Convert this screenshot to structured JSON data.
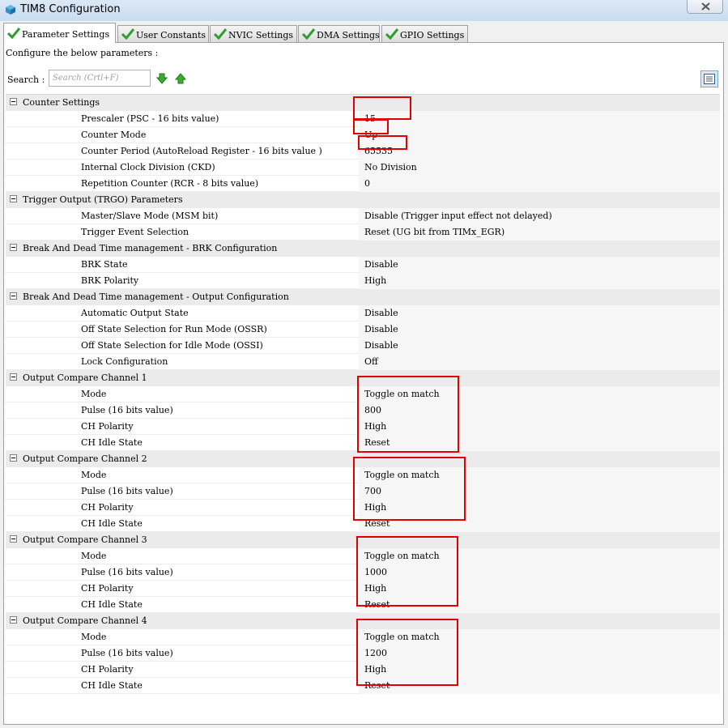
{
  "window": {
    "title": "TIM8 Configuration",
    "icon": "app-cube-icon",
    "close_icon": "close-icon"
  },
  "tabs": [
    {
      "label": "Parameter Settings",
      "active": true,
      "icon": "check-icon"
    },
    {
      "label": "User Constants",
      "active": false,
      "icon": "check-icon"
    },
    {
      "label": "NVIC Settings",
      "active": false,
      "icon": "check-icon"
    },
    {
      "label": "DMA Settings",
      "active": false,
      "icon": "check-icon"
    },
    {
      "label": "GPIO Settings",
      "active": false,
      "icon": "check-icon"
    }
  ],
  "panel": {
    "instruction": "Configure the below parameters :",
    "search_label": "Search :",
    "search_placeholder": "Search (Crtl+F)",
    "next_icon": "arrow-down-icon",
    "prev_icon": "arrow-up-icon",
    "view_icon": "list-view-icon"
  },
  "groups": [
    {
      "title": "Counter Settings",
      "params": [
        {
          "name": "Prescaler (PSC - 16 bits value)",
          "value": "15"
        },
        {
          "name": "Counter Mode",
          "value": "Up"
        },
        {
          "name": "Counter Period (AutoReload Register - 16 bits value )",
          "value": "65535"
        },
        {
          "name": "Internal Clock Division (CKD)",
          "value": "No Division"
        },
        {
          "name": "Repetition Counter (RCR - 8 bits value)",
          "value": "0"
        }
      ]
    },
    {
      "title": "Trigger Output (TRGO) Parameters",
      "params": [
        {
          "name": "Master/Slave Mode (MSM bit)",
          "value": "Disable (Trigger input effect not delayed)"
        },
        {
          "name": "Trigger Event Selection",
          "value": "Reset (UG bit from TIMx_EGR)"
        }
      ]
    },
    {
      "title": "Break And Dead Time management - BRK Configuration",
      "params": [
        {
          "name": "BRK State",
          "value": "Disable"
        },
        {
          "name": "BRK Polarity",
          "value": "High"
        }
      ]
    },
    {
      "title": "Break And Dead Time management - Output Configuration",
      "params": [
        {
          "name": "Automatic Output State",
          "value": "Disable"
        },
        {
          "name": "Off State Selection for Run Mode (OSSR)",
          "value": "Disable"
        },
        {
          "name": "Off State Selection for Idle Mode (OSSI)",
          "value": "Disable"
        },
        {
          "name": "Lock Configuration",
          "value": "Off"
        }
      ]
    },
    {
      "title": "Output Compare Channel 1",
      "params": [
        {
          "name": "Mode",
          "value": "Toggle on match"
        },
        {
          "name": "Pulse (16 bits value)",
          "value": "800"
        },
        {
          "name": "CH Polarity",
          "value": "High"
        },
        {
          "name": "CH Idle State",
          "value": "Reset"
        }
      ]
    },
    {
      "title": "Output Compare Channel 2",
      "params": [
        {
          "name": "Mode",
          "value": "Toggle on match"
        },
        {
          "name": "Pulse (16 bits value)",
          "value": "700"
        },
        {
          "name": "CH Polarity",
          "value": "High"
        },
        {
          "name": "CH Idle State",
          "value": "Reset"
        }
      ]
    },
    {
      "title": "Output Compare Channel 3",
      "params": [
        {
          "name": "Mode",
          "value": "Toggle on match"
        },
        {
          "name": "Pulse (16 bits value)",
          "value": "1000"
        },
        {
          "name": "CH Polarity",
          "value": "High"
        },
        {
          "name": "CH Idle State",
          "value": "Reset"
        }
      ]
    },
    {
      "title": "Output Compare Channel 4",
      "params": [
        {
          "name": "Mode",
          "value": "Toggle on match"
        },
        {
          "name": "Pulse (16 bits value)",
          "value": "1200"
        },
        {
          "name": "CH Polarity",
          "value": "High"
        },
        {
          "name": "CH Idle State",
          "value": "Reset"
        }
      ]
    }
  ],
  "colors": {
    "highlight": "#e00000",
    "check": "#2e9e2e",
    "group_row": "#ebebeb"
  }
}
